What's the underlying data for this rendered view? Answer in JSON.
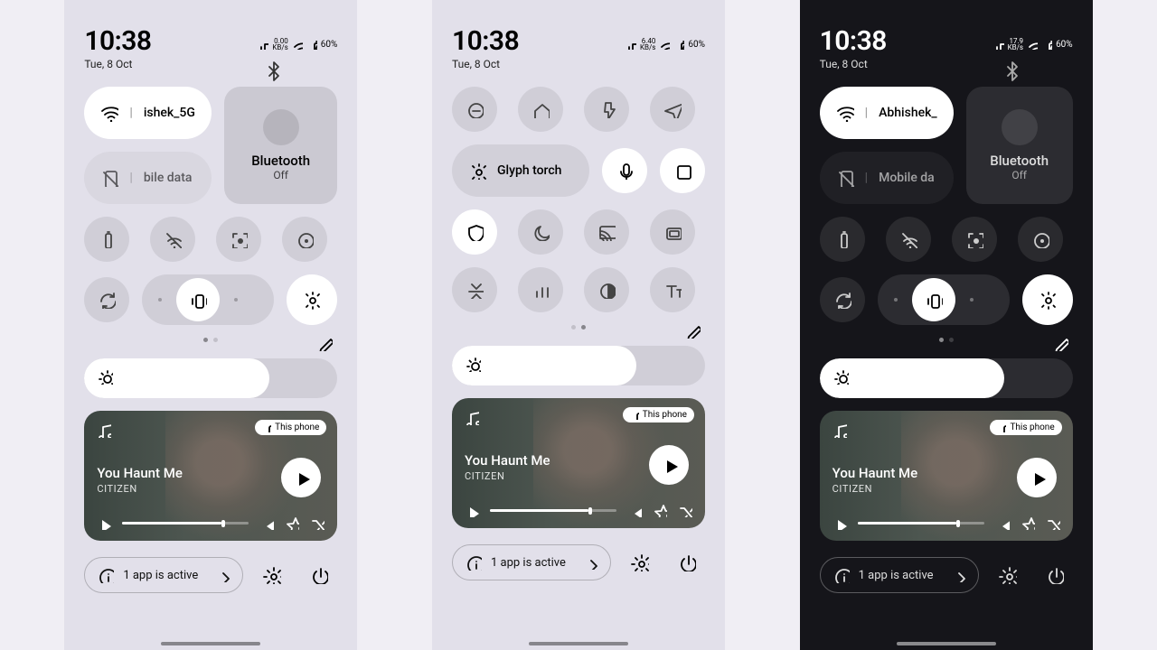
{
  "status": {
    "time": "10:38",
    "date": "Tue, 8 Oct",
    "net_rate1": "0.00",
    "net_rate2": "6.40",
    "net_rate3": "17.9",
    "rate_unit": "KB/s",
    "battery": "60%"
  },
  "tiles": {
    "wifi_name1": "ishek_5G",
    "wifi_name3": "Abhishek_",
    "mobile_data1": "bile data",
    "mobile_data3": "Mobile da",
    "bluetooth_label": "Bluetooth",
    "bluetooth_state": "Off",
    "glyph_torch": "Glyph torch"
  },
  "brightness": {
    "fill_pct": 73
  },
  "media": {
    "device_chip": "This phone",
    "track": "You Haunt Me",
    "artist": "CITIZEN",
    "progress_pct": 78
  },
  "footer": {
    "active_apps": "1 app is active"
  }
}
